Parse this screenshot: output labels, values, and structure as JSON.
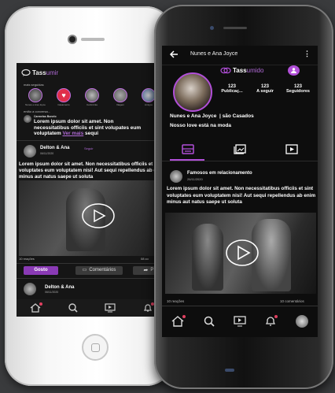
{
  "left_phone": {
    "app_name_prefix": "Tass",
    "app_name_suffix": "umir",
    "stories_heading": "mais seguidas",
    "stories": [
      {
        "label": "Nunes e Ana Joyce"
      },
      {
        "label": "Casamento"
      },
      {
        "label": "Cerimônia"
      },
      {
        "label": "Viagem"
      },
      {
        "label": "Amigos"
      }
    ],
    "comments_heading": "então a conversa...",
    "comment_author": "Carmelas Bonelo",
    "comment_text": "Lorem ipsum dolor sit amet. Non necessitatibus officiis et sint volupates eum voluptatem",
    "comment_link": "Ver mais",
    "comment_tail": "sequi",
    "post_author": "Delton & Ana",
    "post_follow": "Seguir",
    "post_date": "06/11/2020",
    "post_text": "Lorem ipsum dolor sit amet. Non necessitatibus officiis et sint voluptates eum voluptatem nisi! Aut sequi repellendus ab enim minus aut natus saepe ut soluta",
    "reactions": "10 reações",
    "comments_count": "08 co",
    "btn_like": "Gosto",
    "btn_comments": "Comentários",
    "btn_share": "P",
    "next_author": "Delton & Ana",
    "next_date": "06/11/2020"
  },
  "right_phone": {
    "profile_name_header": "Nunes e Ana Joyce",
    "brand_prefix": "Tass",
    "brand_suffix": "umido",
    "stats": [
      {
        "value": "123",
        "label": "Publicaç..."
      },
      {
        "value": "123",
        "label": "A seguir"
      },
      {
        "value": "123",
        "label": "Seguidores"
      }
    ],
    "bio_name": "Nunes e Ana Joyce",
    "bio_status": "| são Casados",
    "bio_text": "Nosso love está na moda",
    "post_author": "Famosos em relacionamento",
    "post_date": "26/11/2020",
    "post_text": "Lorem ipsum dolor sit amet. Non necessitatibus officiis et sint voluptates eum voluptatem nisi! Aut sequi repellendus ab enim minus aut natus saepe ut soluta",
    "reactions": "10 reações",
    "comments": "10 comentários"
  },
  "colors": {
    "accent": "#b14fd8",
    "accent_dark": "#7d2f9e",
    "bg": "#0d0d0d"
  }
}
